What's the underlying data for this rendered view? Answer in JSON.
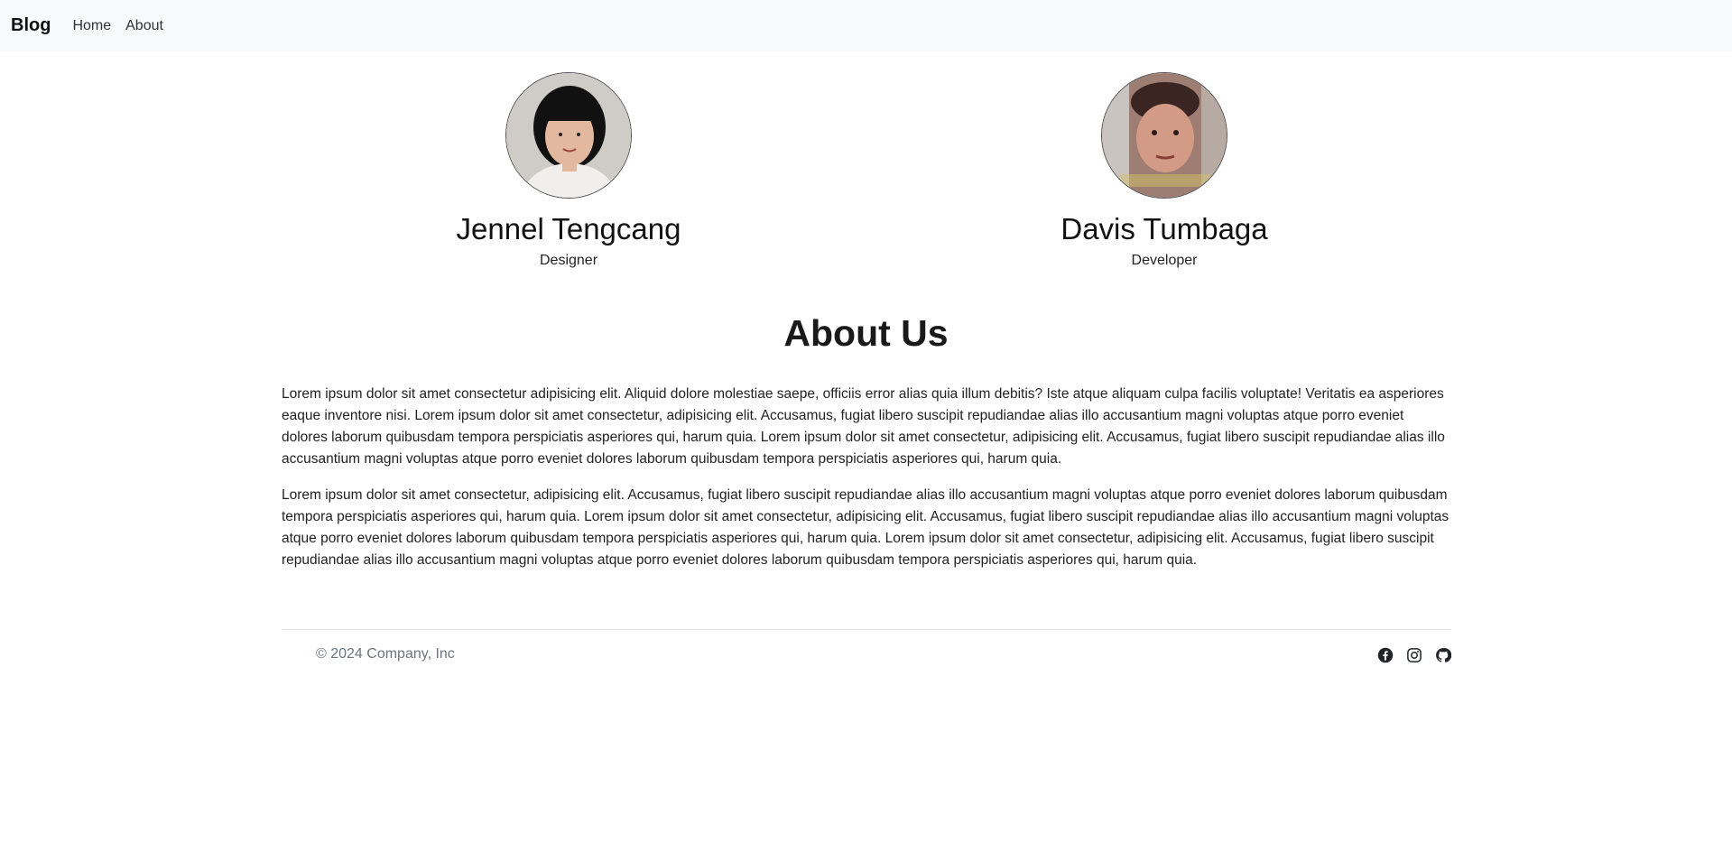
{
  "navbar": {
    "brand": "Blog",
    "links": [
      "Home",
      "About"
    ]
  },
  "team": [
    {
      "name": "Jennel Tengcang",
      "role": "Designer"
    },
    {
      "name": "Davis Tumbaga",
      "role": "Developer"
    }
  ],
  "about": {
    "title": "About Us",
    "paragraphs": [
      "Lorem ipsum dolor sit amet consectetur adipisicing elit. Aliquid dolore molestiae saepe, officiis error alias quia illum debitis? Iste atque aliquam culpa facilis voluptate! Veritatis ea asperiores eaque inventore nisi. Lorem ipsum dolor sit amet consectetur, adipisicing elit. Accusamus, fugiat libero suscipit repudiandae alias illo accusantium magni voluptas atque porro eveniet dolores laborum quibusdam tempora perspiciatis asperiores qui, harum quia. Lorem ipsum dolor sit amet consectetur, adipisicing elit. Accusamus, fugiat libero suscipit repudiandae alias illo accusantium magni voluptas atque porro eveniet dolores laborum quibusdam tempora perspiciatis asperiores qui, harum quia.",
      "Lorem ipsum dolor sit amet consectetur, adipisicing elit. Accusamus, fugiat libero suscipit repudiandae alias illo accusantium magni voluptas atque porro eveniet dolores laborum quibusdam tempora perspiciatis asperiores qui, harum quia. Lorem ipsum dolor sit amet consectetur, adipisicing elit. Accusamus, fugiat libero suscipit repudiandae alias illo accusantium magni voluptas atque porro eveniet dolores laborum quibusdam tempora perspiciatis asperiores qui, harum quia. Lorem ipsum dolor sit amet consectetur, adipisicing elit. Accusamus, fugiat libero suscipit repudiandae alias illo accusantium magni voluptas atque porro eveniet dolores laborum quibusdam tempora perspiciatis asperiores qui, harum quia."
    ]
  },
  "footer": {
    "copyright": "© 2024 Company, Inc",
    "socials": [
      "facebook-icon",
      "instagram-icon",
      "github-icon"
    ]
  },
  "colors": {
    "navbar_bg": "#f8f9fa",
    "text": "#212529",
    "muted": "#6c757d"
  }
}
